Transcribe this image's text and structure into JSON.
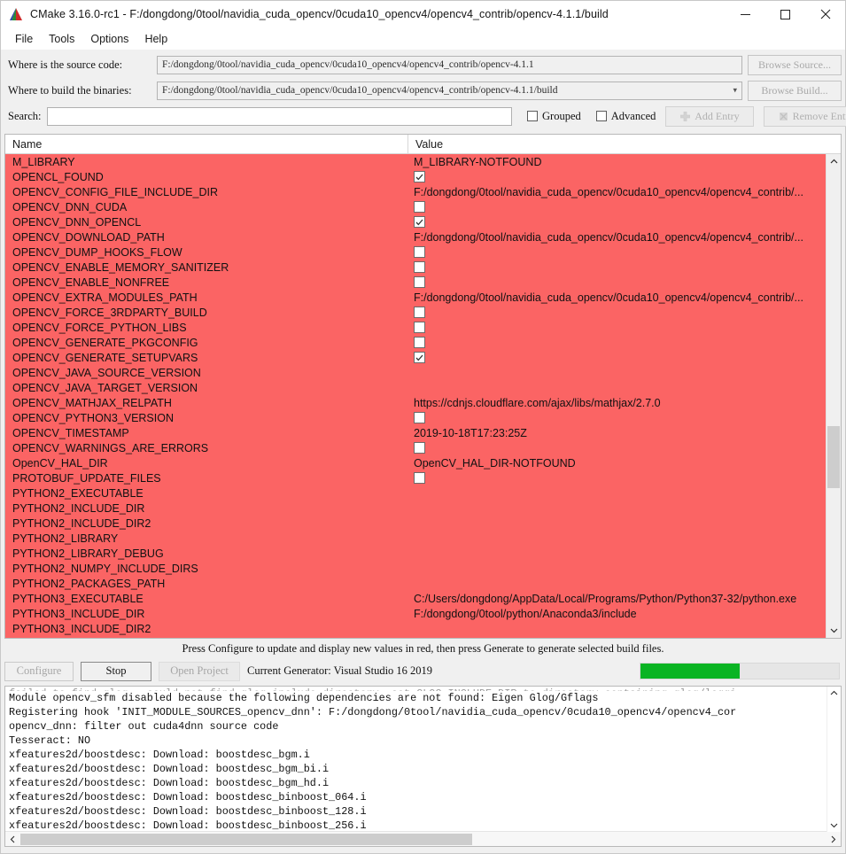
{
  "window": {
    "title": "CMake 3.16.0-rc1 - F:/dongdong/0tool/navidia_cuda_opencv/0cuda10_opencv4/opencv4_contrib/opencv-4.1.1/build",
    "logo_icon": "cmake-triangle-logo",
    "minimize_icon": "minimize-icon",
    "maximize_icon": "maximize-icon",
    "close_icon": "close-icon"
  },
  "menubar": {
    "items": [
      {
        "label": "File"
      },
      {
        "label": "Tools"
      },
      {
        "label": "Options"
      },
      {
        "label": "Help"
      }
    ]
  },
  "form": {
    "source_label": "Where is the source code:",
    "source_value": "F:/dongdong/0tool/navidia_cuda_opencv/0cuda10_opencv4/opencv4_contrib/opencv-4.1.1",
    "browse_source_label": "Browse Source...",
    "build_label": "Where to build the binaries:",
    "build_value": "F:/dongdong/0tool/navidia_cuda_opencv/0cuda10_opencv4/opencv4_contrib/opencv-4.1.1/build",
    "browse_build_label": "Browse Build...",
    "search_label": "Search:",
    "search_value": "",
    "search_placeholder": "",
    "grouped_label": "Grouped",
    "grouped_checked": false,
    "advanced_label": "Advanced",
    "advanced_checked": false,
    "add_entry_label": "Add Entry",
    "remove_entry_label": "Remove Entry"
  },
  "table": {
    "columns": [
      "Name",
      "Value"
    ],
    "rows": [
      {
        "name": "M_LIBRARY",
        "type": "text",
        "value": "M_LIBRARY-NOTFOUND"
      },
      {
        "name": "OPENCL_FOUND",
        "type": "checkbox",
        "checked": true
      },
      {
        "name": "OPENCV_CONFIG_FILE_INCLUDE_DIR",
        "type": "text",
        "value": "F:/dongdong/0tool/navidia_cuda_opencv/0cuda10_opencv4/opencv4_contrib/..."
      },
      {
        "name": "OPENCV_DNN_CUDA",
        "type": "checkbox",
        "checked": false
      },
      {
        "name": "OPENCV_DNN_OPENCL",
        "type": "checkbox",
        "checked": true
      },
      {
        "name": "OPENCV_DOWNLOAD_PATH",
        "type": "text",
        "value": "F:/dongdong/0tool/navidia_cuda_opencv/0cuda10_opencv4/opencv4_contrib/..."
      },
      {
        "name": "OPENCV_DUMP_HOOKS_FLOW",
        "type": "checkbox",
        "checked": false
      },
      {
        "name": "OPENCV_ENABLE_MEMORY_SANITIZER",
        "type": "checkbox",
        "checked": false
      },
      {
        "name": "OPENCV_ENABLE_NONFREE",
        "type": "checkbox",
        "checked": false
      },
      {
        "name": "OPENCV_EXTRA_MODULES_PATH",
        "type": "text",
        "value": "F:/dongdong/0tool/navidia_cuda_opencv/0cuda10_opencv4/opencv4_contrib/..."
      },
      {
        "name": "OPENCV_FORCE_3RDPARTY_BUILD",
        "type": "checkbox",
        "checked": false
      },
      {
        "name": "OPENCV_FORCE_PYTHON_LIBS",
        "type": "checkbox",
        "checked": false
      },
      {
        "name": "OPENCV_GENERATE_PKGCONFIG",
        "type": "checkbox",
        "checked": false
      },
      {
        "name": "OPENCV_GENERATE_SETUPVARS",
        "type": "checkbox",
        "checked": true
      },
      {
        "name": "OPENCV_JAVA_SOURCE_VERSION",
        "type": "empty",
        "value": ""
      },
      {
        "name": "OPENCV_JAVA_TARGET_VERSION",
        "type": "empty",
        "value": ""
      },
      {
        "name": "OPENCV_MATHJAX_RELPATH",
        "type": "text",
        "value": "https://cdnjs.cloudflare.com/ajax/libs/mathjax/2.7.0"
      },
      {
        "name": "OPENCV_PYTHON3_VERSION",
        "type": "checkbox",
        "checked": false
      },
      {
        "name": "OPENCV_TIMESTAMP",
        "type": "text",
        "value": "2019-10-18T17:23:25Z"
      },
      {
        "name": "OPENCV_WARNINGS_ARE_ERRORS",
        "type": "checkbox",
        "checked": false
      },
      {
        "name": "OpenCV_HAL_DIR",
        "type": "text",
        "value": "OpenCV_HAL_DIR-NOTFOUND"
      },
      {
        "name": "PROTOBUF_UPDATE_FILES",
        "type": "checkbox",
        "checked": false
      },
      {
        "name": "PYTHON2_EXECUTABLE",
        "type": "empty",
        "value": ""
      },
      {
        "name": "PYTHON2_INCLUDE_DIR",
        "type": "empty",
        "value": ""
      },
      {
        "name": "PYTHON2_INCLUDE_DIR2",
        "type": "empty",
        "value": ""
      },
      {
        "name": "PYTHON2_LIBRARY",
        "type": "empty",
        "value": ""
      },
      {
        "name": "PYTHON2_LIBRARY_DEBUG",
        "type": "empty",
        "value": ""
      },
      {
        "name": "PYTHON2_NUMPY_INCLUDE_DIRS",
        "type": "empty",
        "value": ""
      },
      {
        "name": "PYTHON2_PACKAGES_PATH",
        "type": "empty",
        "value": ""
      },
      {
        "name": "PYTHON3_EXECUTABLE",
        "type": "text",
        "value": "C:/Users/dongdong/AppData/Local/Programs/Python/Python37-32/python.exe"
      },
      {
        "name": "PYTHON3_INCLUDE_DIR",
        "type": "text",
        "value": "F:/dongdong/0tool/python/Anaconda3/include"
      },
      {
        "name": "PYTHON3_INCLUDE_DIR2",
        "type": "empty",
        "value": ""
      }
    ],
    "row_background_color": "#fb6464",
    "scroll_up_icon": "chevron-up-icon",
    "scroll_down_icon": "chevron-down-icon"
  },
  "status": {
    "hint": "Press Configure to update and display new values in red, then press Generate to generate selected build files.",
    "configure_label": "Configure",
    "stop_label": "Stop",
    "open_project_label": "Open Project",
    "generator_text": "Current Generator: Visual Studio 16 2019",
    "progress_percent": 50,
    "progress_color": "#0ab423"
  },
  "console": {
    "lines": [
      "failed to find glog - could not find glog include directory, set GLOG_INCLUDE_DIR to directory containing glog/loggi",
      "Module opencv_sfm disabled because the following dependencies are not found: Eigen Glog/Gflags",
      "Registering hook 'INIT_MODULE_SOURCES_opencv_dnn': F:/dongdong/0tool/navidia_cuda_opencv/0cuda10_opencv4/opencv4_cor",
      "opencv_dnn: filter out cuda4dnn source code",
      "Tesseract:   NO",
      "xfeatures2d/boostdesc: Download: boostdesc_bgm.i",
      "xfeatures2d/boostdesc: Download: boostdesc_bgm_bi.i",
      "xfeatures2d/boostdesc: Download: boostdesc_bgm_hd.i",
      "xfeatures2d/boostdesc: Download: boostdesc_binboost_064.i",
      "xfeatures2d/boostdesc: Download: boostdesc_binboost_128.i",
      "xfeatures2d/boostdesc: Download: boostdesc_binboost_256.i"
    ],
    "scroll_up_icon": "chevron-up-icon",
    "scroll_down_icon": "chevron-down-icon",
    "scroll_left_icon": "chevron-left-icon",
    "scroll_right_icon": "chevron-right-icon"
  }
}
